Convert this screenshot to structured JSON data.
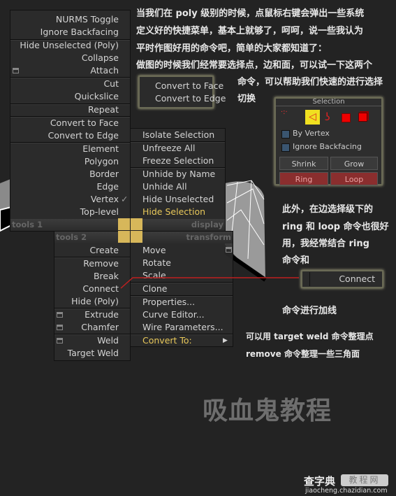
{
  "intro": [
    "当我们在 poly 级别的时候，点鼠标右键会弹出一些系统",
    "定义好的快捷菜单，基本上就够了，呵呵，说一些我认为",
    "平时作图好用的命令吧，简单的大家都知道了：",
    "做图的时候我们经常要选择点，边和面，可以试一下这两个"
  ],
  "intro2": [
    "命令，可以帮助我们快速的进行选择",
    "切换"
  ],
  "popup": [
    "Convert to Face",
    "Convert to Edge"
  ],
  "quad": {
    "tools1": [
      "NURMS Toggle",
      "Ignore Backfacing",
      "Hide Unselected (Poly)",
      "Collapse",
      "Attach",
      "Cut",
      "Quickslice",
      "Repeat",
      "Convert to Face",
      "Convert to Edge",
      "Element",
      "Polygon",
      "Border",
      "Edge",
      "Vertex",
      "Top-level"
    ],
    "display": [
      "Isolate Selection",
      "Unfreeze All",
      "Freeze Selection",
      "Unhide by Name",
      "Unhide All",
      "Hide Unselected",
      "Hide Selection"
    ],
    "tools2": [
      "Create",
      "Remove",
      "Break",
      "Connect",
      "Hide (Poly)",
      "Extrude",
      "Chamfer",
      "Weld",
      "Target Weld"
    ],
    "transform": [
      "Move",
      "Rotate",
      "Scale",
      "Clone",
      "Properties...",
      "Curve Editor...",
      "Wire Parameters...",
      "Convert To:"
    ],
    "labels": {
      "tools1": "tools 1",
      "display": "display",
      "tools2": "tools 2",
      "transform": "transform"
    },
    "checked": "Vertex",
    "highlight_color": "#e8c85a"
  },
  "selection_panel": {
    "title": "Selection",
    "by_vertex": "By Vertex",
    "ignore_backfacing": "Ignore Backfacing",
    "shrink": "Shrink",
    "grow": "Grow",
    "ring": "Ring",
    "loop": "Loop",
    "active_level": "edge"
  },
  "right_text": [
    "此外，在边选择级下的",
    "ring 和 loop 命令也很好",
    "用，我经常结合 ring",
    "命令和"
  ],
  "connect_button": "Connect",
  "after_connect": "命令进行加线",
  "bottom_text": [
    "可以用 target weld 命令整理点",
    "remove 命令整理一些三角面"
  ],
  "watermark": "吸血鬼教程",
  "site_logo": {
    "name": "查字典",
    "tag": "教程网",
    "url": "jiaocheng.chazidian.com"
  }
}
